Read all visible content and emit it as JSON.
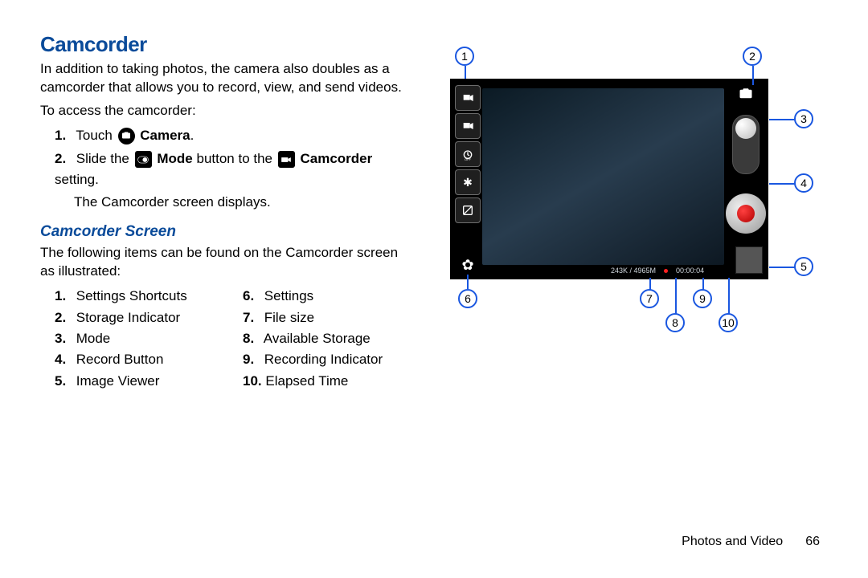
{
  "title": "Camcorder",
  "intro": "In addition to taking photos, the camera also doubles as a camcorder that allows you to record, view, and send videos.",
  "access_line": "To access the camcorder:",
  "steps": {
    "s1_pre": "Touch ",
    "s1_bold": "Camera",
    "s1_post": ".",
    "s2_pre": "Slide the ",
    "s2_mid_bold": "Mode",
    "s2_mid": " button to the ",
    "s2_end_bold": "Camcorder",
    "s2_post": " setting."
  },
  "step_result": "The Camcorder screen displays.",
  "subtitle": "Camcorder Screen",
  "screen_intro": "The following items can be found on the Camcorder screen as illustrated:",
  "legend_left": [
    {
      "num": "1.",
      "label": "Settings Shortcuts"
    },
    {
      "num": "2.",
      "label": "Storage Indicator"
    },
    {
      "num": "3.",
      "label": "Mode"
    },
    {
      "num": "4.",
      "label": "Record Button"
    },
    {
      "num": "5.",
      "label": "Image Viewer"
    }
  ],
  "legend_right": [
    {
      "num": "6.",
      "label": "Settings"
    },
    {
      "num": "7.",
      "label": "File size"
    },
    {
      "num": "8.",
      "label": "Available Storage"
    },
    {
      "num": "9.",
      "label": "Recording Indicator"
    },
    {
      "num": "10.",
      "label": "Elapsed Time"
    }
  ],
  "screenshot": {
    "file_size": "243K / 4965M",
    "elapsed": "00:00:04"
  },
  "callouts": [
    "1",
    "2",
    "3",
    "4",
    "5",
    "6",
    "7",
    "8",
    "9",
    "10"
  ],
  "footer_section": "Photos and Video",
  "footer_page": "66"
}
